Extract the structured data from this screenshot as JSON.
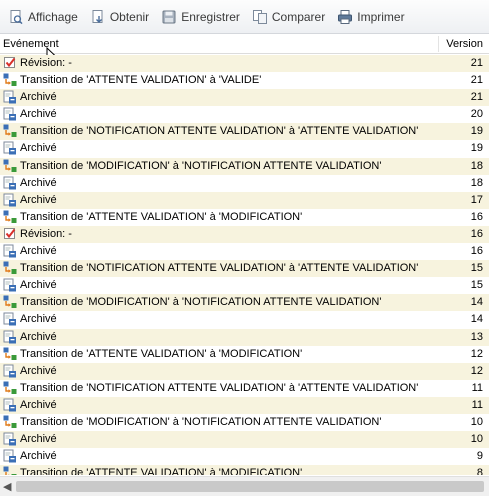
{
  "toolbar": {
    "buttons": [
      {
        "label": "Affichage",
        "icon": "view-page-icon"
      },
      {
        "label": "Obtenir",
        "icon": "get-document-icon"
      },
      {
        "label": "Enregistrer",
        "icon": "save-disk-icon"
      },
      {
        "label": "Comparer",
        "icon": "compare-documents-icon"
      },
      {
        "label": "Imprimer",
        "icon": "printer-icon"
      }
    ]
  },
  "columns": {
    "event": "Evénement",
    "version": "Version"
  },
  "rows": [
    {
      "type": "revision",
      "text": "Révision: -",
      "version": "21"
    },
    {
      "type": "transition",
      "text": "Transition de 'ATTENTE VALIDATION' à 'VALIDE'",
      "version": "21"
    },
    {
      "type": "archive",
      "text": "Archivé",
      "version": "21"
    },
    {
      "type": "archive",
      "text": "Archivé",
      "version": "20"
    },
    {
      "type": "transition",
      "text": "Transition de 'NOTIFICATION ATTENTE VALIDATION' à 'ATTENTE VALIDATION'",
      "version": "19"
    },
    {
      "type": "archive",
      "text": "Archivé",
      "version": "19"
    },
    {
      "type": "transition",
      "text": "Transition de 'MODIFICATION' à 'NOTIFICATION ATTENTE VALIDATION'",
      "version": "18"
    },
    {
      "type": "archive",
      "text": "Archivé",
      "version": "18"
    },
    {
      "type": "archive",
      "text": "Archivé",
      "version": "17"
    },
    {
      "type": "transition",
      "text": "Transition de 'ATTENTE VALIDATION' à 'MODIFICATION'",
      "version": "16"
    },
    {
      "type": "revision",
      "text": "Révision: -",
      "version": "16"
    },
    {
      "type": "archive",
      "text": "Archivé",
      "version": "16"
    },
    {
      "type": "transition",
      "text": "Transition de 'NOTIFICATION ATTENTE VALIDATION' à 'ATTENTE VALIDATION'",
      "version": "15"
    },
    {
      "type": "archive",
      "text": "Archivé",
      "version": "15"
    },
    {
      "type": "transition",
      "text": "Transition de 'MODIFICATION' à 'NOTIFICATION ATTENTE VALIDATION'",
      "version": "14"
    },
    {
      "type": "archive",
      "text": "Archivé",
      "version": "14"
    },
    {
      "type": "archive",
      "text": "Archivé",
      "version": "13"
    },
    {
      "type": "transition",
      "text": "Transition de 'ATTENTE VALIDATION' à 'MODIFICATION'",
      "version": "12"
    },
    {
      "type": "archive",
      "text": "Archivé",
      "version": "12"
    },
    {
      "type": "transition",
      "text": "Transition de 'NOTIFICATION ATTENTE VALIDATION' à 'ATTENTE VALIDATION'",
      "version": "11"
    },
    {
      "type": "archive",
      "text": "Archivé",
      "version": "11"
    },
    {
      "type": "transition",
      "text": "Transition de 'MODIFICATION' à 'NOTIFICATION ATTENTE VALIDATION'",
      "version": "10"
    },
    {
      "type": "archive",
      "text": "Archivé",
      "version": "10"
    },
    {
      "type": "archive",
      "text": "Archivé",
      "version": "9"
    },
    {
      "type": "transition",
      "text": "Transition de 'ATTENTE VALIDATION' à 'MODIFICATION'",
      "version": "8"
    }
  ],
  "colors": {
    "row_alt": "#f7f3de",
    "revision_red": "#d9302a",
    "archive_blue": "#3b6fb6",
    "transition_green": "#3a9a3a",
    "transition_orange": "#e07b1a"
  }
}
